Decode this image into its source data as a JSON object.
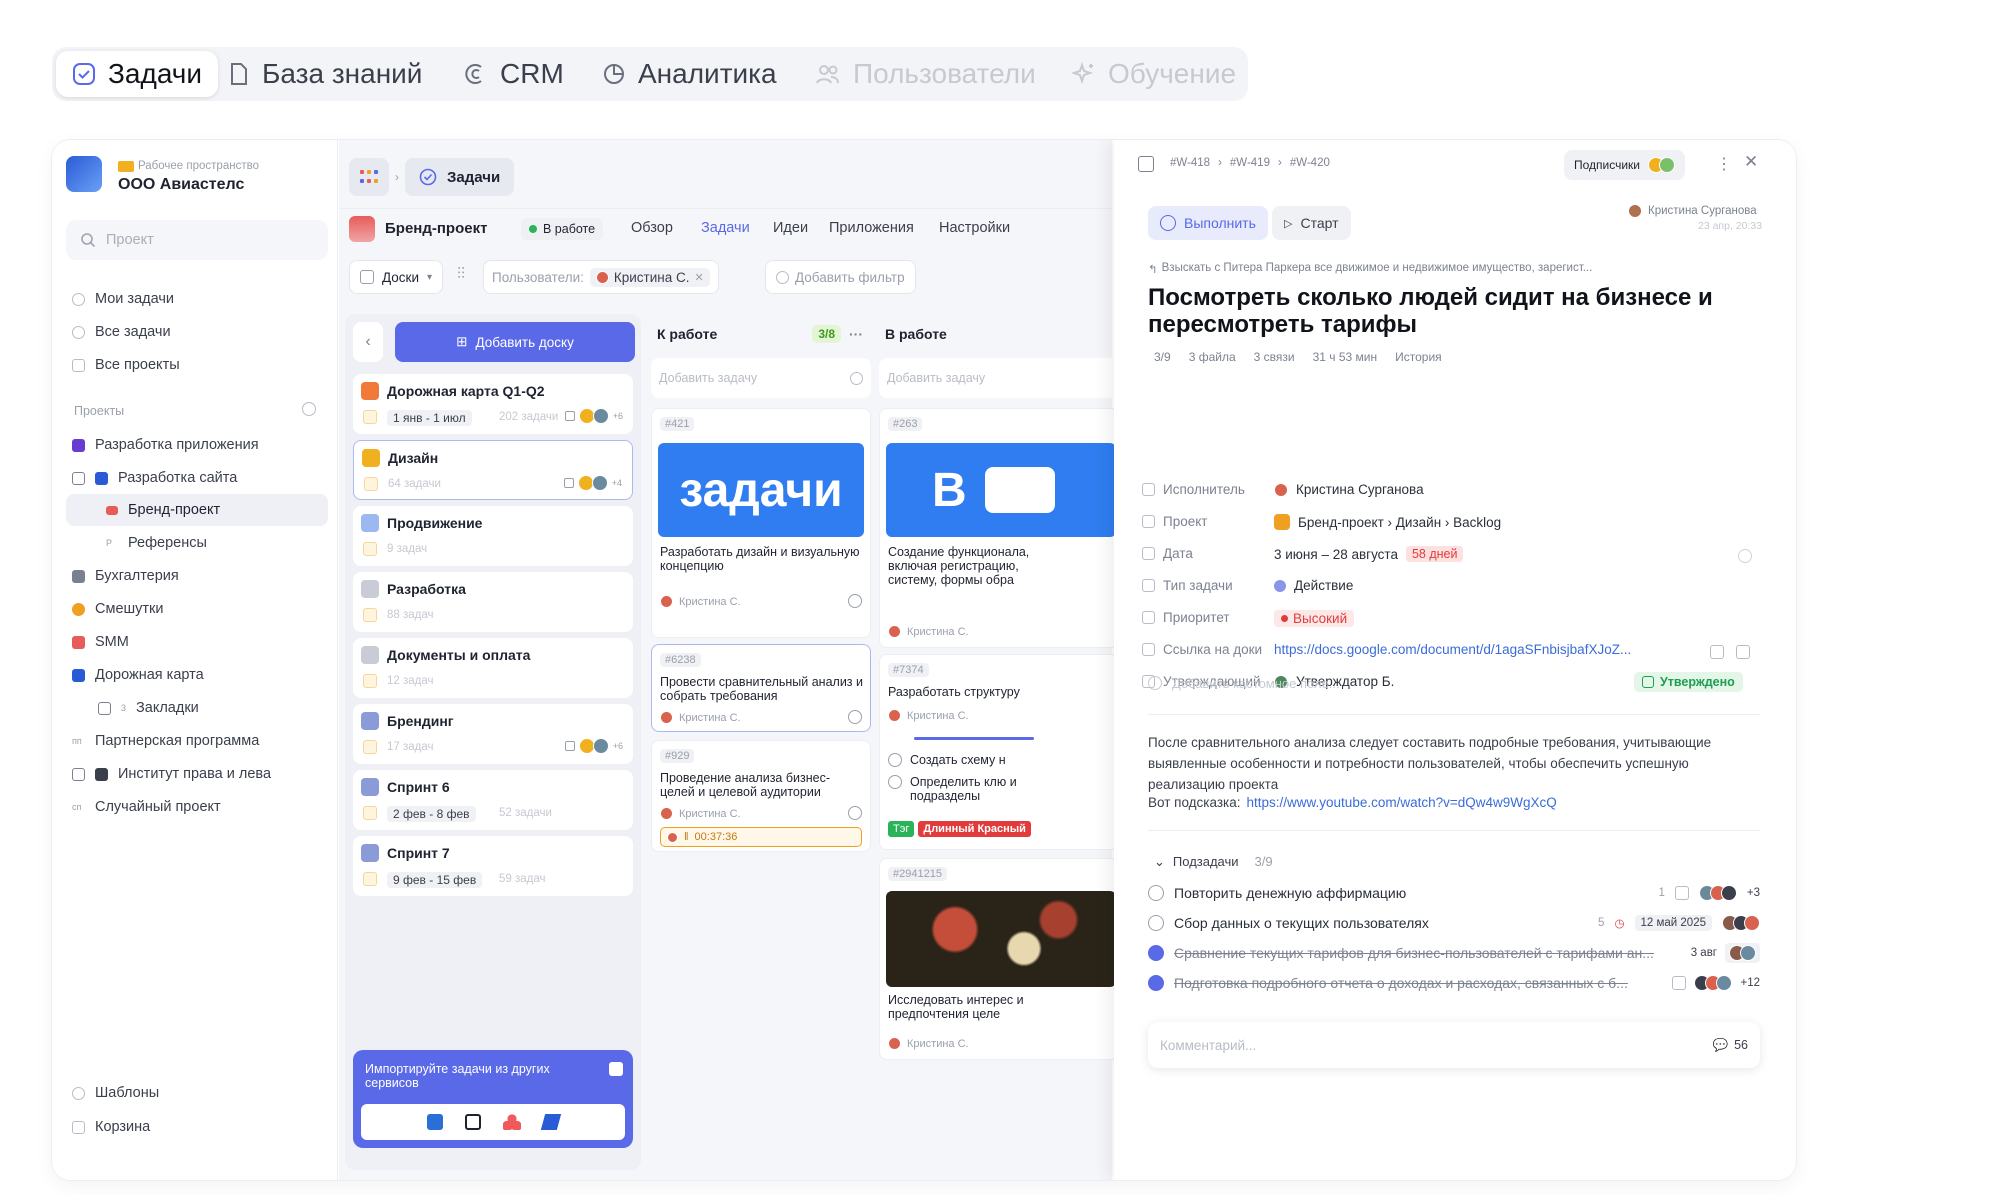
{
  "topnav": [
    {
      "label": "Задачи",
      "icon": "check-circle-icon",
      "state": "active"
    },
    {
      "label": "База знаний",
      "icon": "document-icon",
      "state": "normal"
    },
    {
      "label": "CRM",
      "icon": "crm-icon",
      "state": "normal"
    },
    {
      "label": "Аналитика",
      "icon": "pie-chart-icon",
      "state": "normal"
    },
    {
      "label": "Пользователи",
      "icon": "users-icon",
      "state": "muted"
    },
    {
      "label": "Обучение",
      "icon": "sparkle-icon",
      "state": "muted"
    }
  ],
  "workspace": {
    "caption": "Рабочее пространство",
    "name": "ООО Авиастелс"
  },
  "search": {
    "placeholder": "Проект"
  },
  "sidebar_top": [
    "Мои задачи",
    "Все задачи",
    "Все проекты"
  ],
  "projects_title": "Проекты",
  "projects": [
    {
      "label": "Разработка приложения",
      "color": "#6a3bd1"
    },
    {
      "label": "Разработка сайта",
      "color": "#2a5bd7"
    },
    {
      "label": "Бренд-проект",
      "color": "#e85b5b"
    },
    {
      "label": "Референсы",
      "color": "#c9ccd6"
    },
    {
      "label": "Бухгалтерия",
      "color": "#7a8090"
    },
    {
      "label": "Смешутки",
      "color": "#f0a020"
    },
    {
      "label": "SMM",
      "color": "#e85b5b"
    },
    {
      "label": "Дорожная карта",
      "color": "#2a5bd7"
    },
    {
      "label": "Закладки",
      "color": "#9aa0ab",
      "badge": "3"
    },
    {
      "label": "Партнерская программа",
      "color": "#9aa0ab"
    },
    {
      "label": "Институт права и лева",
      "color": "#3a3f4b"
    },
    {
      "label": "Случайный проект",
      "color": "#9aa0ab"
    }
  ],
  "sidebar_bottom": [
    "Шаблоны",
    "Корзина"
  ],
  "breadcrumb": {
    "current": "Задачи"
  },
  "project_bar": {
    "name": "Бренд-проект",
    "status": "В работе",
    "tabs": [
      "Обзор",
      "Задачи",
      "Идеи",
      "Приложения",
      "Настройки"
    ]
  },
  "filters": {
    "boards": "Доски",
    "users_label": "Пользователи:",
    "user": "Кристина С.",
    "add": "Добавить фильтр"
  },
  "boards_panel": {
    "add_label": "Добавить доску",
    "items": [
      {
        "name": "Дорожная карта Q1-Q2",
        "meta": "202 задачи",
        "dates": "1 янв - 1 июл",
        "color": "#f07a3a",
        "more": "+6"
      },
      {
        "name": "Дизайн",
        "meta": "64 задачи",
        "color": "#f0b020",
        "more": "+4"
      },
      {
        "name": "Продвижение",
        "meta": "9 задач",
        "color": "#9cb8f0"
      },
      {
        "name": "Разработка",
        "meta": "88 задач",
        "color": "#c9ccd6"
      },
      {
        "name": "Документы и оплата",
        "meta": "12 задач",
        "color": "#c9ccd6"
      },
      {
        "name": "Брендинг",
        "meta": "17 задач",
        "color": "#8a9bd8",
        "more": "+6"
      },
      {
        "name": "Спринт 6",
        "meta": "52 задачи",
        "dates": "2 фев - 8 фев",
        "color": "#8a9bd8"
      },
      {
        "name": "Спринт 7",
        "meta": "59 задач",
        "dates": "9 фев - 15 фев",
        "color": "#8a9bd8"
      }
    ],
    "import_title": "Импортируйте задачи из других сервисов"
  },
  "columns": [
    {
      "title": "К работе",
      "count": "3/8",
      "add": "Добавить задачу"
    },
    {
      "title": "В работе",
      "add": "Добавить задачу"
    }
  ],
  "col1_cards": [
    {
      "id": "#421",
      "image_text": "задачи",
      "title": "Разработать дизайн и визуальную концепцию",
      "user": "Кристина С."
    },
    {
      "id": "#6238",
      "title": "Провести сравнительный анализ и собрать требования",
      "user": "Кристина С."
    },
    {
      "id": "#929",
      "title": "Проведение анализа бизнес-целей и целевой аудитории",
      "user": "Кристина С.",
      "timer": "00:37:36"
    }
  ],
  "col2_cards": [
    {
      "id": "#263",
      "image_text": "В",
      "title": "Создание функционала, включая регистрацию, систему, формы обра",
      "user": "Кристина С."
    },
    {
      "id": "#7374",
      "title": "Разработать структуру",
      "user": "Кристина С.",
      "checks": [
        "Создать схему н",
        "Определить клю и подразделы"
      ],
      "tags": [
        "Тэг",
        "Длинный Красный"
      ]
    },
    {
      "id": "#2941215",
      "title": "Исследовать интерес и предпочтения целе",
      "user": "Кристина С."
    }
  ],
  "detail": {
    "crumbs": [
      "#W-418",
      "#W-419",
      "#W-420"
    ],
    "subscribers": "Подписчики",
    "btn_done": "Выполнить",
    "btn_start": "Старт",
    "author": "Кристина Сурганова",
    "author_time": "23 апр, 20:33",
    "parent": "Взыскать с Питера Паркера все движимое и недвижимое имущество, зарегист...",
    "title": "Посмотреть сколько людей сидит на бизнесе и пересмотреть тарифы",
    "meta": [
      "3/9",
      "3 файла",
      "3 связи",
      "31 ч 53 мин",
      "История"
    ],
    "props": [
      {
        "label": "Исполнитель",
        "value": "Кристина Сурганова",
        "icon": "user-icon"
      },
      {
        "label": "Проект",
        "value": "Бренд-проект  ›  Дизайн  ›  Backlog",
        "icon": "folder-icon"
      },
      {
        "label": "Дата",
        "value": "3 июня – 28 августа",
        "badge": "58 дней",
        "icon": "calendar-icon"
      },
      {
        "label": "Тип задачи",
        "value": "Действие",
        "icon": "type-icon"
      },
      {
        "label": "Приоритет",
        "value": "Высокий",
        "icon": "priority-icon"
      },
      {
        "label": "Ссылка на доки",
        "value": "https://docs.google.com/document/d/1agaSFnbisjbafXJoZ...",
        "icon": "link-icon"
      },
      {
        "label": "Утверждающий",
        "value": "Утверждатор Б.",
        "badge": "Утверждено",
        "icon": "approver-icon"
      }
    ],
    "add_field": "Добавить кастомное поле...",
    "description": "После сравнительного анализа следует составить подробные требования, учитывающие выявленные особенности и потребности пользователей, чтобы обеспечить успешную реализацию проекта",
    "hint_label": "Вот подсказка:",
    "hint_link": "https://www.youtube.com/watch?v=dQw4w9WgXcQ",
    "subtasks_title": "Подзадачи",
    "subtasks_count": "3/9",
    "subtasks": [
      {
        "text": "Повторить денежную аффирмацию",
        "done": false,
        "links": "1",
        "extra": "+3"
      },
      {
        "text": "Сбор данных о текущих пользователях",
        "done": false,
        "links": "5",
        "date": "12 май 2025"
      },
      {
        "text": "Сравнение текущих тарифов для бизнес-пользователей с тарифами ан...",
        "done": true,
        "date": "3 авг"
      },
      {
        "text": "Подготовка подробного отчета о доходах и расходах, связанных с б...",
        "done": true,
        "extra": "+12"
      }
    ],
    "comment_placeholder": "Комментарий...",
    "comment_count": "56"
  },
  "colors": {
    "accent": "#5969e8",
    "bg": "#f5f6f9",
    "red": "#e23b3b",
    "green": "#1f9d52"
  }
}
